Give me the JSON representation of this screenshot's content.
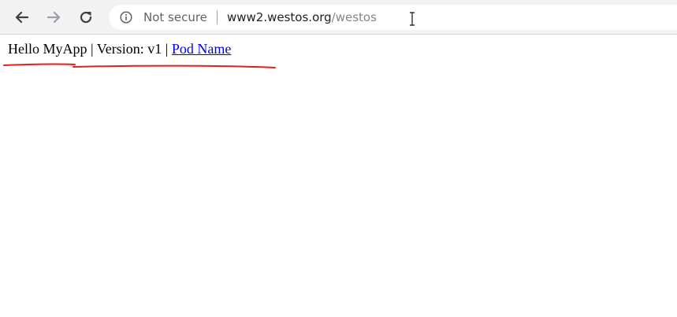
{
  "browser": {
    "security_label": "Not secure",
    "url_host": "www2.westos.org",
    "url_path": "/westos",
    "icons": [
      "back-arrow-icon",
      "forward-arrow-icon",
      "reload-icon",
      "info-icon",
      "text-cursor-icon"
    ]
  },
  "page": {
    "greeting": "Hello MyApp",
    "separator1": " | ",
    "version": "Version: v1",
    "separator2": " | ",
    "link_text": "Pod Name"
  },
  "colors": {
    "link": "#0000ee",
    "annotation": "#e0201b",
    "toolbar_bg": "#f2f2f2"
  }
}
